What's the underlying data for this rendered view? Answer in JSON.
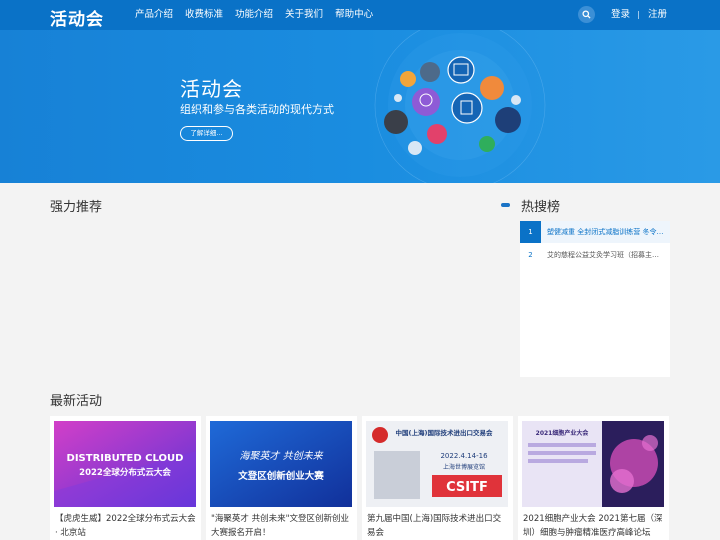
{
  "header": {
    "logo": "活动会",
    "nav": [
      "产品介绍",
      "收费标准",
      "功能介绍",
      "关于我们",
      "帮助中心"
    ],
    "login": "登录",
    "register": "注册"
  },
  "hero": {
    "title": "活动会",
    "subtitle": "组织和参与各类活动的现代方式",
    "button": "了解详细..."
  },
  "recommend": {
    "title": "强力推荐"
  },
  "hot": {
    "title": "热搜榜",
    "items": [
      {
        "rank": "1",
        "text": "塑健减重 全封闭式减脂训练营 冬令营..."
      },
      {
        "rank": "2",
        "text": "艾的慈程公益艾灸学习班（招募主办方）"
      }
    ]
  },
  "latest": {
    "title": "最新活动",
    "cards": [
      {
        "text": "【虎虎生威】2022全球分布式云大会 · 北京站",
        "img_text": "DISTRIBUTED CLOUD 2022全球分布式云大会"
      },
      {
        "text": "\"海聚英才 共创未来\"文登区创新创业大赛报名开启！",
        "img_text": "海聚英才 共创未来 文登区创新创业大赛"
      },
      {
        "text": "第九届中国(上海)国际技术进出口交易会",
        "img_text": "中国(上海)国际技术进出口交易会 2022.4.14-16 上海世博展览馆 CSITF"
      },
      {
        "text": "2021细胞产业大会 2021第七届（深圳）细胞与肿瘤精准医疗高峰论坛",
        "img_text": "2021细胞产业大会"
      }
    ]
  },
  "colors": {
    "brand": "#0a72c7",
    "hero": "#1a8de0"
  }
}
